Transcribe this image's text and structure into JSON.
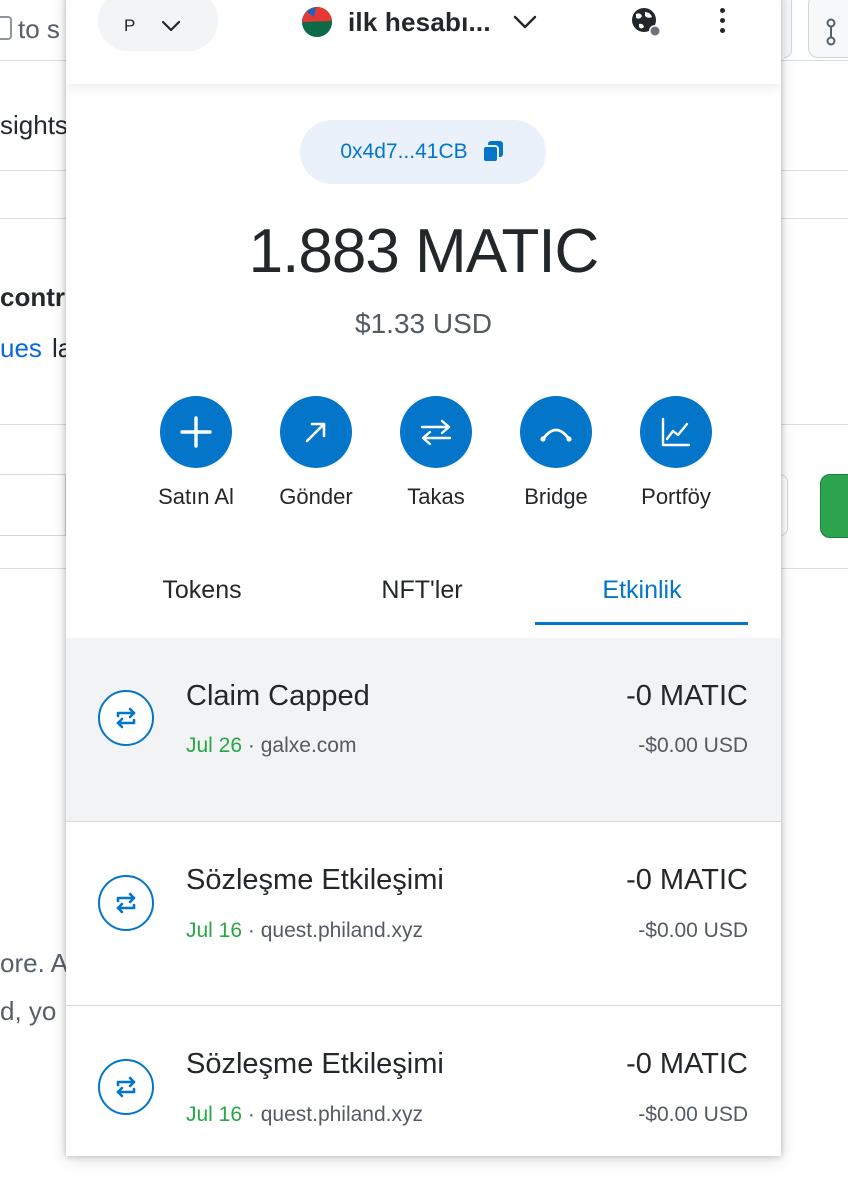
{
  "background": {
    "tab_fragment": "to s",
    "nav_fragment": "sights",
    "heading_fragment": "contr",
    "link_fragment": "ues",
    "link_trailing": "la",
    "body_fragment_1": "ore. A",
    "body_fragment_2": "d, yo"
  },
  "header": {
    "network_initial": "P",
    "account_name": "ilk hesabı...",
    "icons": [
      "chevron-down-icon",
      "globe-status-icon",
      "kebab-menu-icon"
    ]
  },
  "wallet": {
    "address": "0x4d7...41CB",
    "balance": "1.883 MATIC",
    "fiat_balance": "$1.33 USD"
  },
  "actions": [
    {
      "label": "Satın Al",
      "icon": "plus-icon"
    },
    {
      "label": "Gönder",
      "icon": "arrow-up-right-icon"
    },
    {
      "label": "Takas",
      "icon": "swap-arrows-icon"
    },
    {
      "label": "Bridge",
      "icon": "bridge-icon"
    },
    {
      "label": "Portföy",
      "icon": "chart-icon"
    }
  ],
  "tabs": [
    {
      "label": "Tokens",
      "active": false
    },
    {
      "label": "NFT'ler",
      "active": false
    },
    {
      "label": "Etkinlik",
      "active": true
    }
  ],
  "activity": [
    {
      "title": "Claim Capped",
      "date": "Jul 26",
      "separator": "·",
      "origin": "galxe.com",
      "amount": "-0 MATIC",
      "fiat": "-$0.00 USD"
    },
    {
      "title": "Sözleşme Etkileşimi",
      "date": "Jul 16",
      "separator": "·",
      "origin": "quest.philand.xyz",
      "amount": "-0 MATIC",
      "fiat": "-$0.00 USD"
    },
    {
      "title": "Sözleşme Etkileşimi",
      "date": "Jul 16",
      "separator": "·",
      "origin": "quest.philand.xyz",
      "amount": "-0 MATIC",
      "fiat": "-$0.00 USD"
    }
  ],
  "colors": {
    "primary": "#0376c9",
    "success": "#28a745",
    "text": "#24272a",
    "muted": "#535a61"
  }
}
